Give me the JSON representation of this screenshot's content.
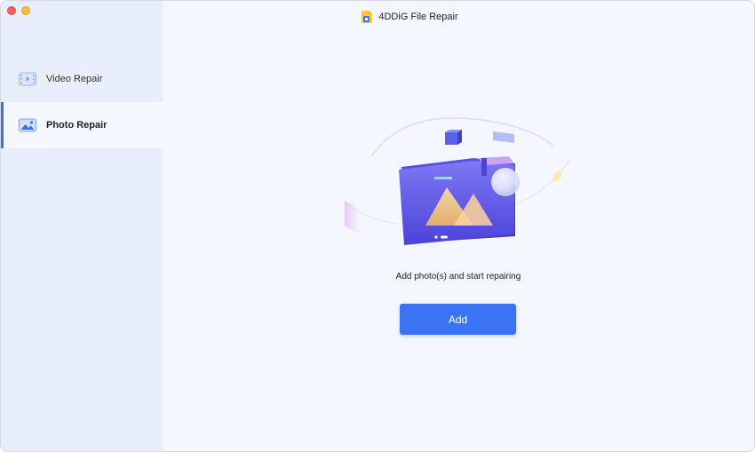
{
  "window": {
    "app_title": "4DDiG File Repair"
  },
  "sidebar": {
    "items": [
      {
        "label": "Video Repair",
        "icon": "video-icon",
        "active": false
      },
      {
        "label": "Photo Repair",
        "icon": "photo-icon",
        "active": true
      }
    ]
  },
  "main": {
    "prompt": "Add photo(s) and start repairing",
    "add_label": "Add"
  },
  "colors": {
    "accent": "#3b74f2",
    "sidebar_bg": "#e8effa",
    "main_bg": "#f4f7fd"
  }
}
